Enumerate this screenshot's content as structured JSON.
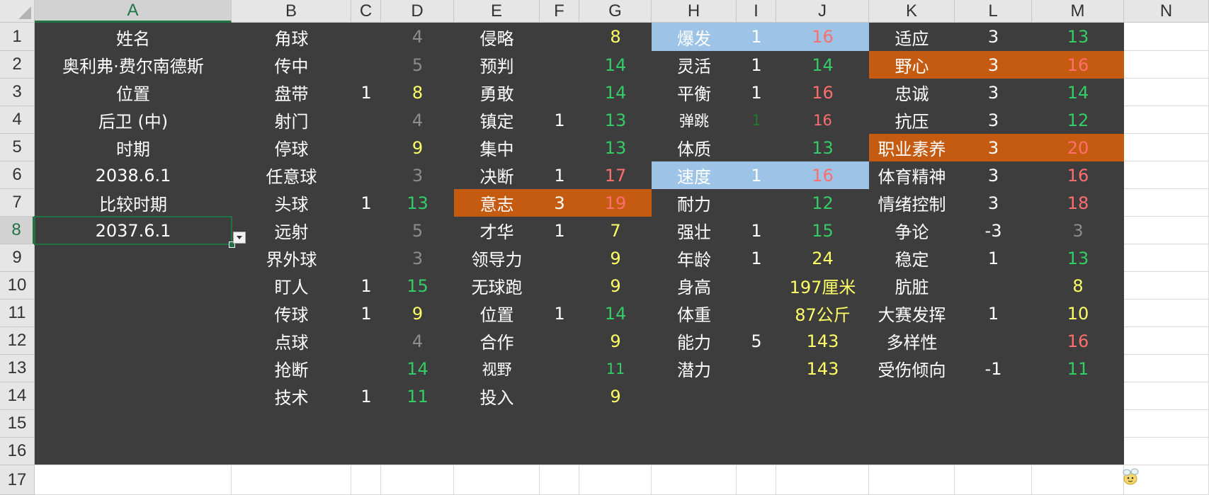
{
  "columns": [
    "A",
    "B",
    "C",
    "D",
    "E",
    "F",
    "G",
    "H",
    "I",
    "J",
    "K",
    "L",
    "M",
    "N"
  ],
  "rows": [
    "1",
    "2",
    "3",
    "4",
    "5",
    "6",
    "7",
    "8",
    "9",
    "10",
    "11",
    "12",
    "13",
    "14",
    "15",
    "16",
    "17"
  ],
  "selected": {
    "col": "A",
    "row": "8"
  },
  "colors": {
    "white": "#ffffff",
    "grey": "#8c8c8c",
    "yellow": "#ffff66",
    "green": "#33cc66",
    "red": "#ff6e6e",
    "darkgreen": "#1d7a2f",
    "sheet_bg": "#3d3d3d",
    "blue_fill": "#9dc3e6",
    "orange_fill": "#c55a11",
    "selection": "#217346"
  },
  "cells": [
    {
      "c": "A",
      "r": 1,
      "v": "姓名",
      "color": "white"
    },
    {
      "c": "A",
      "r": 2,
      "v": "奥利弗·费尔南德斯",
      "color": "white"
    },
    {
      "c": "A",
      "r": 3,
      "v": "位置",
      "color": "white"
    },
    {
      "c": "A",
      "r": 4,
      "v": "后卫 (中)",
      "color": "white"
    },
    {
      "c": "A",
      "r": 5,
      "v": "时期",
      "color": "white"
    },
    {
      "c": "A",
      "r": 6,
      "v": "2038.6.1",
      "color": "white"
    },
    {
      "c": "A",
      "r": 7,
      "v": "比较时期",
      "color": "white"
    },
    {
      "c": "A",
      "r": 8,
      "v": "2037.6.1",
      "color": "white"
    },
    {
      "c": "B",
      "r": 1,
      "v": "角球",
      "color": "white"
    },
    {
      "c": "B",
      "r": 2,
      "v": "传中",
      "color": "white"
    },
    {
      "c": "B",
      "r": 3,
      "v": "盘带",
      "color": "white"
    },
    {
      "c": "B",
      "r": 4,
      "v": "射门",
      "color": "white"
    },
    {
      "c": "B",
      "r": 5,
      "v": "停球",
      "color": "white"
    },
    {
      "c": "B",
      "r": 6,
      "v": "任意球",
      "color": "white"
    },
    {
      "c": "B",
      "r": 7,
      "v": "头球",
      "color": "white"
    },
    {
      "c": "B",
      "r": 8,
      "v": "远射",
      "color": "white"
    },
    {
      "c": "B",
      "r": 9,
      "v": "界外球",
      "color": "white"
    },
    {
      "c": "B",
      "r": 10,
      "v": "盯人",
      "color": "white"
    },
    {
      "c": "B",
      "r": 11,
      "v": "传球",
      "color": "white"
    },
    {
      "c": "B",
      "r": 12,
      "v": "点球",
      "color": "white"
    },
    {
      "c": "B",
      "r": 13,
      "v": "抢断",
      "color": "white"
    },
    {
      "c": "B",
      "r": 14,
      "v": "技术",
      "color": "white"
    },
    {
      "c": "C",
      "r": 3,
      "v": "1",
      "color": "white"
    },
    {
      "c": "C",
      "r": 7,
      "v": "1",
      "color": "white"
    },
    {
      "c": "C",
      "r": 10,
      "v": "1",
      "color": "white"
    },
    {
      "c": "C",
      "r": 11,
      "v": "1",
      "color": "white"
    },
    {
      "c": "C",
      "r": 14,
      "v": "1",
      "color": "white"
    },
    {
      "c": "D",
      "r": 1,
      "v": "4",
      "color": "grey"
    },
    {
      "c": "D",
      "r": 2,
      "v": "5",
      "color": "grey"
    },
    {
      "c": "D",
      "r": 3,
      "v": "8",
      "color": "yellow"
    },
    {
      "c": "D",
      "r": 4,
      "v": "4",
      "color": "grey"
    },
    {
      "c": "D",
      "r": 5,
      "v": "9",
      "color": "yellow"
    },
    {
      "c": "D",
      "r": 6,
      "v": "3",
      "color": "grey"
    },
    {
      "c": "D",
      "r": 7,
      "v": "13",
      "color": "green"
    },
    {
      "c": "D",
      "r": 8,
      "v": "5",
      "color": "grey"
    },
    {
      "c": "D",
      "r": 9,
      "v": "3",
      "color": "grey"
    },
    {
      "c": "D",
      "r": 10,
      "v": "15",
      "color": "green"
    },
    {
      "c": "D",
      "r": 11,
      "v": "9",
      "color": "yellow"
    },
    {
      "c": "D",
      "r": 12,
      "v": "4",
      "color": "grey"
    },
    {
      "c": "D",
      "r": 13,
      "v": "14",
      "color": "green"
    },
    {
      "c": "D",
      "r": 14,
      "v": "11",
      "color": "green"
    },
    {
      "c": "E",
      "r": 1,
      "v": "侵略",
      "color": "white"
    },
    {
      "c": "E",
      "r": 2,
      "v": "预判",
      "color": "white"
    },
    {
      "c": "E",
      "r": 3,
      "v": "勇敢",
      "color": "white"
    },
    {
      "c": "E",
      "r": 4,
      "v": "镇定",
      "color": "white"
    },
    {
      "c": "E",
      "r": 5,
      "v": "集中",
      "color": "white"
    },
    {
      "c": "E",
      "r": 6,
      "v": "决断",
      "color": "white"
    },
    {
      "c": "E",
      "r": 7,
      "v": "意志",
      "color": "white",
      "fill": "orange_fill"
    },
    {
      "c": "E",
      "r": 8,
      "v": "才华",
      "color": "white"
    },
    {
      "c": "E",
      "r": 9,
      "v": "领导力",
      "color": "white"
    },
    {
      "c": "E",
      "r": 10,
      "v": "无球跑",
      "color": "white"
    },
    {
      "c": "E",
      "r": 11,
      "v": "位置",
      "color": "white"
    },
    {
      "c": "E",
      "r": 12,
      "v": "合作",
      "color": "white"
    },
    {
      "c": "E",
      "r": 13,
      "v": "视野",
      "color": "white",
      "small": true
    },
    {
      "c": "E",
      "r": 14,
      "v": "投入",
      "color": "white"
    },
    {
      "c": "F",
      "r": 4,
      "v": "1",
      "color": "white"
    },
    {
      "c": "F",
      "r": 6,
      "v": "1",
      "color": "white"
    },
    {
      "c": "F",
      "r": 7,
      "v": "3",
      "color": "white",
      "fill": "orange_fill"
    },
    {
      "c": "F",
      "r": 8,
      "v": "1",
      "color": "white"
    },
    {
      "c": "F",
      "r": 11,
      "v": "1",
      "color": "white"
    },
    {
      "c": "G",
      "r": 1,
      "v": "8",
      "color": "yellow"
    },
    {
      "c": "G",
      "r": 2,
      "v": "14",
      "color": "green"
    },
    {
      "c": "G",
      "r": 3,
      "v": "14",
      "color": "green"
    },
    {
      "c": "G",
      "r": 4,
      "v": "13",
      "color": "green"
    },
    {
      "c": "G",
      "r": 5,
      "v": "13",
      "color": "green"
    },
    {
      "c": "G",
      "r": 6,
      "v": "17",
      "color": "red"
    },
    {
      "c": "G",
      "r": 7,
      "v": "19",
      "color": "red",
      "fill": "orange_fill"
    },
    {
      "c": "G",
      "r": 8,
      "v": "7",
      "color": "yellow"
    },
    {
      "c": "G",
      "r": 9,
      "v": "9",
      "color": "yellow"
    },
    {
      "c": "G",
      "r": 10,
      "v": "9",
      "color": "yellow"
    },
    {
      "c": "G",
      "r": 11,
      "v": "14",
      "color": "green"
    },
    {
      "c": "G",
      "r": 12,
      "v": "9",
      "color": "yellow"
    },
    {
      "c": "G",
      "r": 13,
      "v": "11",
      "color": "green",
      "small": true
    },
    {
      "c": "G",
      "r": 14,
      "v": "9",
      "color": "yellow"
    },
    {
      "c": "H",
      "r": 1,
      "v": "爆发",
      "color": "white",
      "fill": "blue_fill"
    },
    {
      "c": "H",
      "r": 2,
      "v": "灵活",
      "color": "white"
    },
    {
      "c": "H",
      "r": 3,
      "v": "平衡",
      "color": "white"
    },
    {
      "c": "H",
      "r": 4,
      "v": "弹跳",
      "color": "white",
      "small": true
    },
    {
      "c": "H",
      "r": 5,
      "v": "体质",
      "color": "white"
    },
    {
      "c": "H",
      "r": 6,
      "v": "速度",
      "color": "white",
      "fill": "blue_fill"
    },
    {
      "c": "H",
      "r": 7,
      "v": "耐力",
      "color": "white"
    },
    {
      "c": "H",
      "r": 8,
      "v": "强壮",
      "color": "white"
    },
    {
      "c": "H",
      "r": 9,
      "v": "年龄",
      "color": "white"
    },
    {
      "c": "H",
      "r": 10,
      "v": "身高",
      "color": "white"
    },
    {
      "c": "H",
      "r": 11,
      "v": "体重",
      "color": "white"
    },
    {
      "c": "H",
      "r": 12,
      "v": "能力",
      "color": "white"
    },
    {
      "c": "H",
      "r": 13,
      "v": "潜力",
      "color": "white"
    },
    {
      "c": "I",
      "r": 1,
      "v": "1",
      "color": "white",
      "fill": "blue_fill"
    },
    {
      "c": "I",
      "r": 2,
      "v": "1",
      "color": "white"
    },
    {
      "c": "I",
      "r": 3,
      "v": "1",
      "color": "white"
    },
    {
      "c": "I",
      "r": 4,
      "v": "1",
      "color": "darkgreen",
      "small": true
    },
    {
      "c": "I",
      "r": 6,
      "v": "1",
      "color": "white",
      "fill": "blue_fill"
    },
    {
      "c": "I",
      "r": 8,
      "v": "1",
      "color": "white"
    },
    {
      "c": "I",
      "r": 9,
      "v": "1",
      "color": "white"
    },
    {
      "c": "I",
      "r": 12,
      "v": "5",
      "color": "white"
    },
    {
      "c": "J",
      "r": 1,
      "v": "16",
      "color": "red",
      "fill": "blue_fill"
    },
    {
      "c": "J",
      "r": 2,
      "v": "14",
      "color": "green"
    },
    {
      "c": "J",
      "r": 3,
      "v": "16",
      "color": "red"
    },
    {
      "c": "J",
      "r": 4,
      "v": "16",
      "color": "red",
      "small": true
    },
    {
      "c": "J",
      "r": 5,
      "v": "13",
      "color": "green"
    },
    {
      "c": "J",
      "r": 6,
      "v": "16",
      "color": "red",
      "fill": "blue_fill"
    },
    {
      "c": "J",
      "r": 7,
      "v": "12",
      "color": "green"
    },
    {
      "c": "J",
      "r": 8,
      "v": "15",
      "color": "green"
    },
    {
      "c": "J",
      "r": 9,
      "v": "24",
      "color": "yellow"
    },
    {
      "c": "J",
      "r": 10,
      "v": "197厘米",
      "color": "yellow"
    },
    {
      "c": "J",
      "r": 11,
      "v": "87公斤",
      "color": "yellow"
    },
    {
      "c": "J",
      "r": 12,
      "v": "143",
      "color": "yellow"
    },
    {
      "c": "J",
      "r": 13,
      "v": "143",
      "color": "yellow"
    },
    {
      "c": "K",
      "r": 1,
      "v": "适应",
      "color": "white"
    },
    {
      "c": "K",
      "r": 2,
      "v": "野心",
      "color": "white",
      "fill": "orange_fill"
    },
    {
      "c": "K",
      "r": 3,
      "v": "忠诚",
      "color": "white"
    },
    {
      "c": "K",
      "r": 4,
      "v": "抗压",
      "color": "white"
    },
    {
      "c": "K",
      "r": 5,
      "v": "职业素养",
      "color": "white",
      "fill": "orange_fill"
    },
    {
      "c": "K",
      "r": 6,
      "v": "体育精神",
      "color": "white"
    },
    {
      "c": "K",
      "r": 7,
      "v": "情绪控制",
      "color": "white"
    },
    {
      "c": "K",
      "r": 8,
      "v": "争论",
      "color": "white"
    },
    {
      "c": "K",
      "r": 9,
      "v": "稳定",
      "color": "white"
    },
    {
      "c": "K",
      "r": 10,
      "v": "肮脏",
      "color": "white"
    },
    {
      "c": "K",
      "r": 11,
      "v": "大赛发挥",
      "color": "white"
    },
    {
      "c": "K",
      "r": 12,
      "v": "多样性",
      "color": "white"
    },
    {
      "c": "K",
      "r": 13,
      "v": "受伤倾向",
      "color": "white"
    },
    {
      "c": "L",
      "r": 1,
      "v": "3",
      "color": "white"
    },
    {
      "c": "L",
      "r": 2,
      "v": "3",
      "color": "white",
      "fill": "orange_fill"
    },
    {
      "c": "L",
      "r": 3,
      "v": "3",
      "color": "white"
    },
    {
      "c": "L",
      "r": 4,
      "v": "3",
      "color": "white"
    },
    {
      "c": "L",
      "r": 5,
      "v": "3",
      "color": "white",
      "fill": "orange_fill"
    },
    {
      "c": "L",
      "r": 6,
      "v": "3",
      "color": "white"
    },
    {
      "c": "L",
      "r": 7,
      "v": "3",
      "color": "white"
    },
    {
      "c": "L",
      "r": 8,
      "v": "-3",
      "color": "white"
    },
    {
      "c": "L",
      "r": 9,
      "v": "1",
      "color": "white"
    },
    {
      "c": "L",
      "r": 11,
      "v": "1",
      "color": "white"
    },
    {
      "c": "L",
      "r": 13,
      "v": "-1",
      "color": "white"
    },
    {
      "c": "M",
      "r": 1,
      "v": "13",
      "color": "green"
    },
    {
      "c": "M",
      "r": 2,
      "v": "16",
      "color": "red",
      "fill": "orange_fill"
    },
    {
      "c": "M",
      "r": 3,
      "v": "14",
      "color": "green"
    },
    {
      "c": "M",
      "r": 4,
      "v": "12",
      "color": "green"
    },
    {
      "c": "M",
      "r": 5,
      "v": "20",
      "color": "red",
      "fill": "orange_fill"
    },
    {
      "c": "M",
      "r": 6,
      "v": "16",
      "color": "red"
    },
    {
      "c": "M",
      "r": 7,
      "v": "18",
      "color": "red"
    },
    {
      "c": "M",
      "r": 8,
      "v": "3",
      "color": "grey"
    },
    {
      "c": "M",
      "r": 9,
      "v": "13",
      "color": "green"
    },
    {
      "c": "M",
      "r": 10,
      "v": "8",
      "color": "yellow"
    },
    {
      "c": "M",
      "r": 11,
      "v": "10",
      "color": "yellow"
    },
    {
      "c": "M",
      "r": 12,
      "v": "16",
      "color": "red"
    },
    {
      "c": "M",
      "r": 13,
      "v": "11",
      "color": "green"
    }
  ]
}
